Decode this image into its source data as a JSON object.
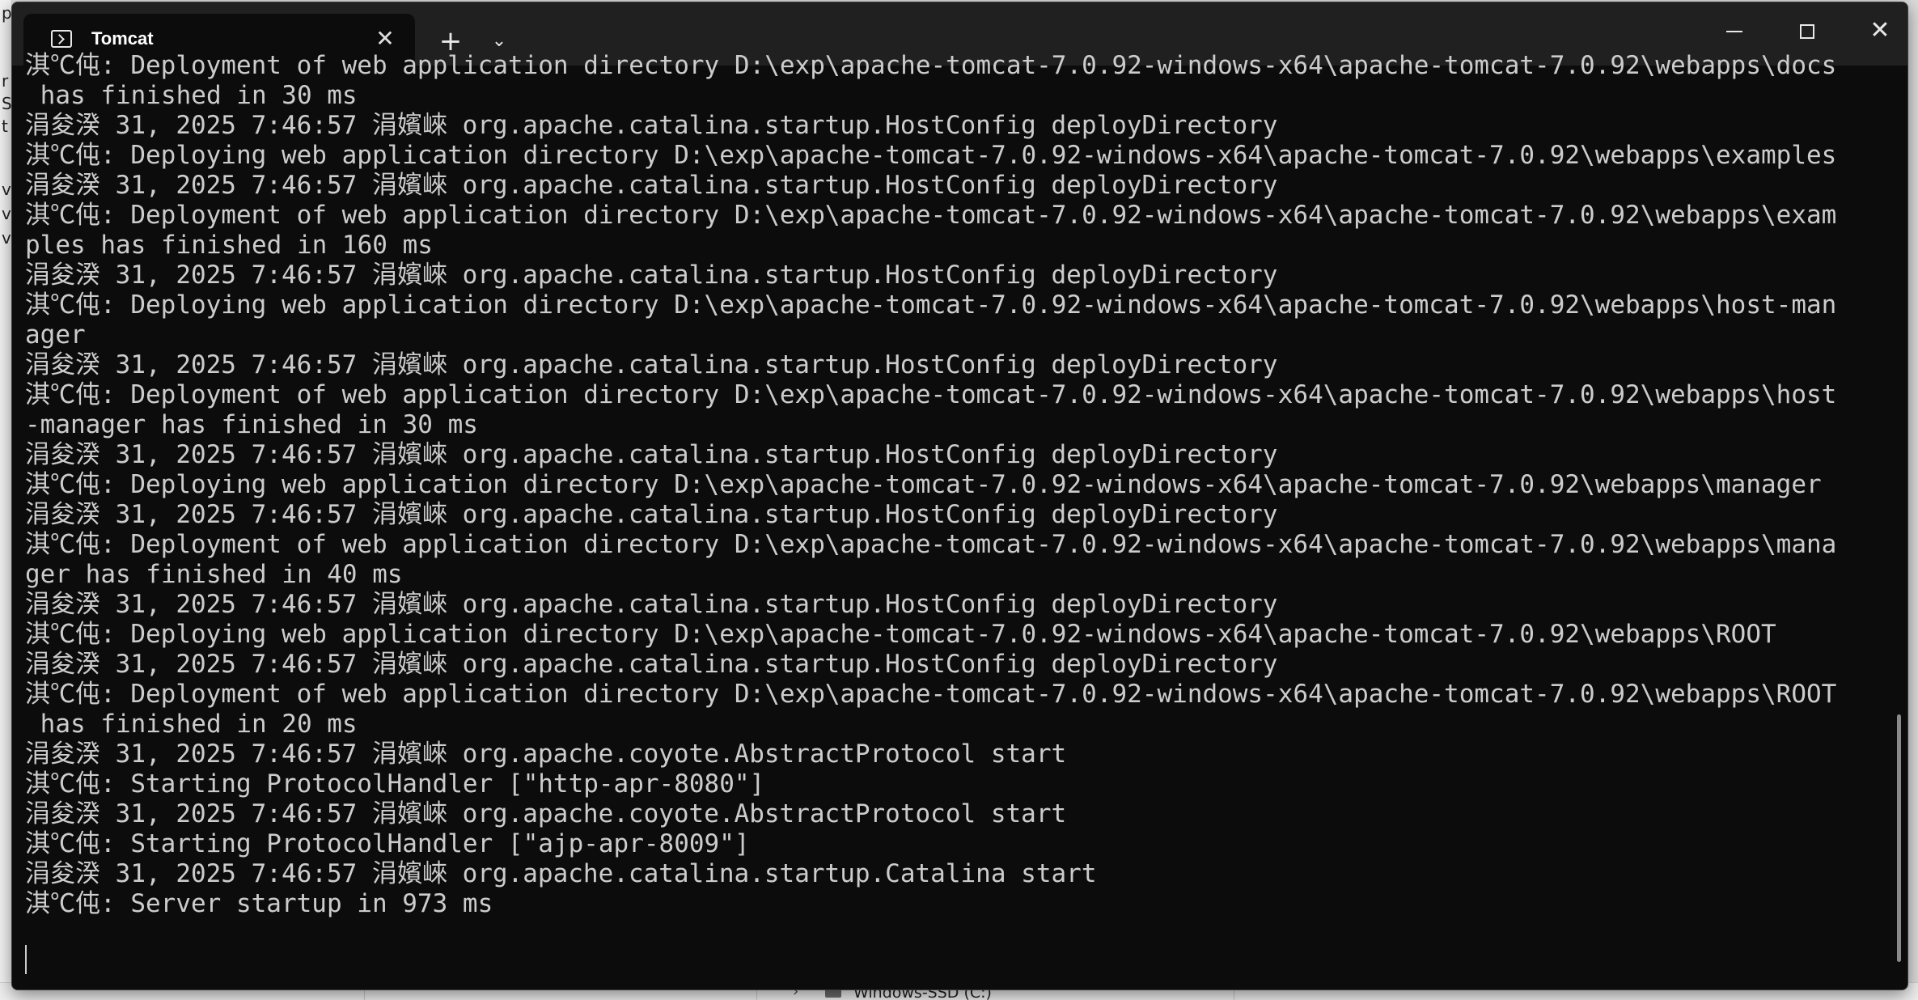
{
  "window": {
    "tab_title": "Tomcat",
    "tab_close": "✕",
    "new_tab": "+",
    "tab_dropdown": "⌄",
    "close_glyph": "✕"
  },
  "background": {
    "left_chars": [
      "p",
      "r",
      "S",
      "t",
      "v",
      "v",
      "v"
    ],
    "drive_label": "Windows-SSD (C:)",
    "explorer_chevron": "›"
  },
  "console": {
    "lines": [
      "淇℃伅: Deployment of web application directory D:\\exp\\apache-tomcat-7.0.92-windows-x64\\apache-tomcat-7.0.92\\webapps\\docs",
      " has finished in 30 ms",
      "涓夋湀 31, 2025 7:46:57 涓嬪崍 org.apache.catalina.startup.HostConfig deployDirectory",
      "淇℃伅: Deploying web application directory D:\\exp\\apache-tomcat-7.0.92-windows-x64\\apache-tomcat-7.0.92\\webapps\\examples",
      "涓夋湀 31, 2025 7:46:57 涓嬪崍 org.apache.catalina.startup.HostConfig deployDirectory",
      "淇℃伅: Deployment of web application directory D:\\exp\\apache-tomcat-7.0.92-windows-x64\\apache-tomcat-7.0.92\\webapps\\exam",
      "ples has finished in 160 ms",
      "涓夋湀 31, 2025 7:46:57 涓嬪崍 org.apache.catalina.startup.HostConfig deployDirectory",
      "淇℃伅: Deploying web application directory D:\\exp\\apache-tomcat-7.0.92-windows-x64\\apache-tomcat-7.0.92\\webapps\\host-man",
      "ager",
      "涓夋湀 31, 2025 7:46:57 涓嬪崍 org.apache.catalina.startup.HostConfig deployDirectory",
      "淇℃伅: Deployment of web application directory D:\\exp\\apache-tomcat-7.0.92-windows-x64\\apache-tomcat-7.0.92\\webapps\\host",
      "-manager has finished in 30 ms",
      "涓夋湀 31, 2025 7:46:57 涓嬪崍 org.apache.catalina.startup.HostConfig deployDirectory",
      "淇℃伅: Deploying web application directory D:\\exp\\apache-tomcat-7.0.92-windows-x64\\apache-tomcat-7.0.92\\webapps\\manager",
      "涓夋湀 31, 2025 7:46:57 涓嬪崍 org.apache.catalina.startup.HostConfig deployDirectory",
      "淇℃伅: Deployment of web application directory D:\\exp\\apache-tomcat-7.0.92-windows-x64\\apache-tomcat-7.0.92\\webapps\\mana",
      "ger has finished in 40 ms",
      "涓夋湀 31, 2025 7:46:57 涓嬪崍 org.apache.catalina.startup.HostConfig deployDirectory",
      "淇℃伅: Deploying web application directory D:\\exp\\apache-tomcat-7.0.92-windows-x64\\apache-tomcat-7.0.92\\webapps\\ROOT",
      "涓夋湀 31, 2025 7:46:57 涓嬪崍 org.apache.catalina.startup.HostConfig deployDirectory",
      "淇℃伅: Deployment of web application directory D:\\exp\\apache-tomcat-7.0.92-windows-x64\\apache-tomcat-7.0.92\\webapps\\ROOT",
      " has finished in 20 ms",
      "涓夋湀 31, 2025 7:46:57 涓嬪崍 org.apache.coyote.AbstractProtocol start",
      "淇℃伅: Starting ProtocolHandler [\"http-apr-8080\"]",
      "涓夋湀 31, 2025 7:46:57 涓嬪崍 org.apache.coyote.AbstractProtocol start",
      "淇℃伅: Starting ProtocolHandler [\"ajp-apr-8009\"]",
      "涓夋湀 31, 2025 7:46:57 涓嬪崍 org.apache.catalina.startup.Catalina start",
      "淇℃伅: Server startup in 973 ms"
    ]
  }
}
